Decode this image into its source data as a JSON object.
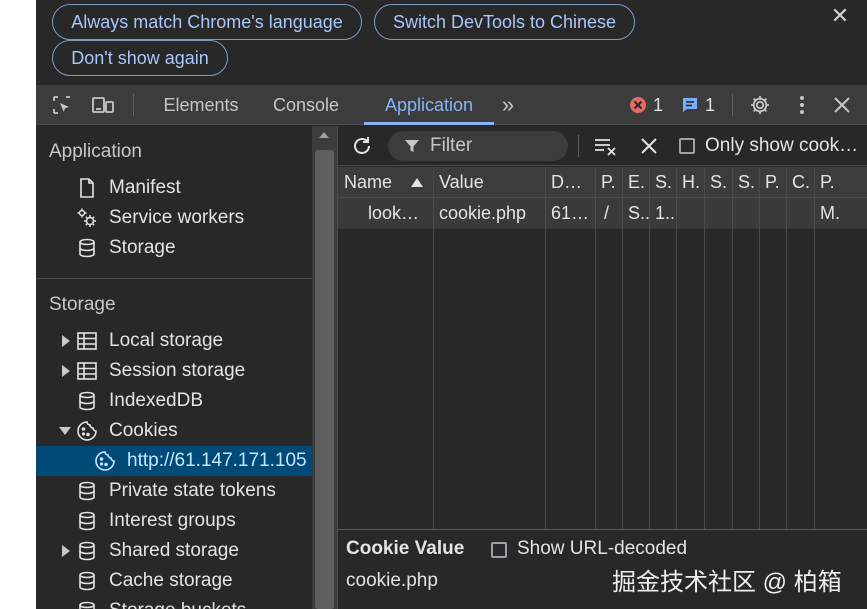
{
  "infobar": {
    "match_language": "Always match Chrome's language",
    "switch_language": "Switch DevTools to Chinese",
    "dont_show": "Don't show again",
    "close_glyph": "✕"
  },
  "toolbar": {
    "tabs": [
      "Elements",
      "Console",
      "Application"
    ],
    "more_tabs": "»",
    "error_count": "1",
    "message_count": "1",
    "error_color": "#e46962",
    "message_color": "#7cacf8",
    "accent": "#8ab4f8"
  },
  "sidebar": {
    "application_header": "Application",
    "application_items": [
      "Manifest",
      "Service workers",
      "Storage"
    ],
    "storage_header": "Storage",
    "storage_items": [
      "Local storage",
      "Session storage",
      "IndexedDB",
      "Cookies",
      "http://61.147.171.105",
      "Private state tokens",
      "Interest groups",
      "Shared storage",
      "Cache storage",
      "Storage buckets"
    ]
  },
  "cookies": {
    "filter_placeholder": "Filter",
    "only_show_label": "Only show cook…",
    "columns": [
      "Name",
      "Value",
      "D…",
      "P.",
      "E.",
      "S.",
      "H.",
      "S.",
      "S.",
      "P.",
      "C.",
      "P."
    ],
    "rows": [
      [
        "look…",
        "cookie.php",
        "61…",
        "/",
        "S..",
        "1..",
        "",
        "",
        "",
        "",
        "",
        "M."
      ]
    ]
  },
  "cookie_value": {
    "title": "Cookie Value",
    "show_decoded_label": "Show URL-decoded",
    "value": "cookie.php"
  },
  "watermark": "掘金技术社区 @ 柏箱"
}
